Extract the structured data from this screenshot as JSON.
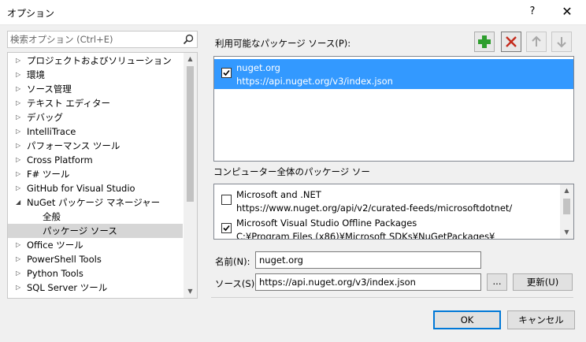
{
  "window": {
    "title": "オプション",
    "help_label": "?",
    "close_label": "✕"
  },
  "search": {
    "placeholder": "検索オプション (Ctrl+E)",
    "value": ""
  },
  "tree": {
    "items": [
      {
        "label": "プロジェクトおよびソリューション",
        "expandable": true,
        "child": false,
        "selected": false
      },
      {
        "label": "環境",
        "expandable": true,
        "child": false,
        "selected": false
      },
      {
        "label": "ソース管理",
        "expandable": true,
        "child": false,
        "selected": false
      },
      {
        "label": "テキスト エディター",
        "expandable": true,
        "child": false,
        "selected": false
      },
      {
        "label": "デバッグ",
        "expandable": true,
        "child": false,
        "selected": false
      },
      {
        "label": "IntelliTrace",
        "expandable": true,
        "child": false,
        "selected": false
      },
      {
        "label": "パフォーマンス ツール",
        "expandable": true,
        "child": false,
        "selected": false
      },
      {
        "label": "Cross Platform",
        "expandable": true,
        "child": false,
        "selected": false
      },
      {
        "label": "F# ツール",
        "expandable": true,
        "child": false,
        "selected": false
      },
      {
        "label": "GitHub for Visual Studio",
        "expandable": true,
        "child": false,
        "selected": false
      },
      {
        "label": "NuGet パッケージ マネージャー",
        "expandable": true,
        "expanded": true,
        "child": false,
        "selected": false
      },
      {
        "label": "全般",
        "expandable": false,
        "child": true,
        "selected": false
      },
      {
        "label": "パッケージ ソース",
        "expandable": false,
        "child": true,
        "selected": true
      },
      {
        "label": "Office ツール",
        "expandable": true,
        "child": false,
        "selected": false
      },
      {
        "label": "PowerShell Tools",
        "expandable": true,
        "child": false,
        "selected": false
      },
      {
        "label": "Python Tools",
        "expandable": true,
        "child": false,
        "selected": false
      },
      {
        "label": "SQL Server ツール",
        "expandable": true,
        "child": false,
        "selected": false
      }
    ]
  },
  "sources": {
    "label": "利用可能なパッケージ ソース(P):",
    "items": [
      {
        "name": "nuget.org",
        "url": "https://api.nuget.org/v3/index.json",
        "checked": true,
        "selected": true
      }
    ]
  },
  "machine_sources": {
    "label": "コンピューター全体のパッケージ ソー",
    "items": [
      {
        "name": "Microsoft and .NET",
        "url": "https://www.nuget.org/api/v2/curated-feeds/microsoftdotnet/",
        "checked": false
      },
      {
        "name": "Microsoft Visual Studio Offline Packages",
        "url": "C:¥Program Files (x86)¥Microsoft SDKs¥NuGetPackages¥",
        "checked": true
      }
    ]
  },
  "form": {
    "name_label": "名前(N):",
    "name_value": "nuget.org",
    "source_label": "ソース(S):",
    "source_value": "https://api.nuget.org/v3/index.json",
    "browse_label": "...",
    "update_label": "更新(U)"
  },
  "buttons": {
    "ok": "OK",
    "cancel": "キャンセル"
  },
  "colors": {
    "selection": "#3399ff",
    "add_icon": "#2e9e2e",
    "remove_icon": "#c42b1c",
    "default_border": "#0078d7"
  }
}
